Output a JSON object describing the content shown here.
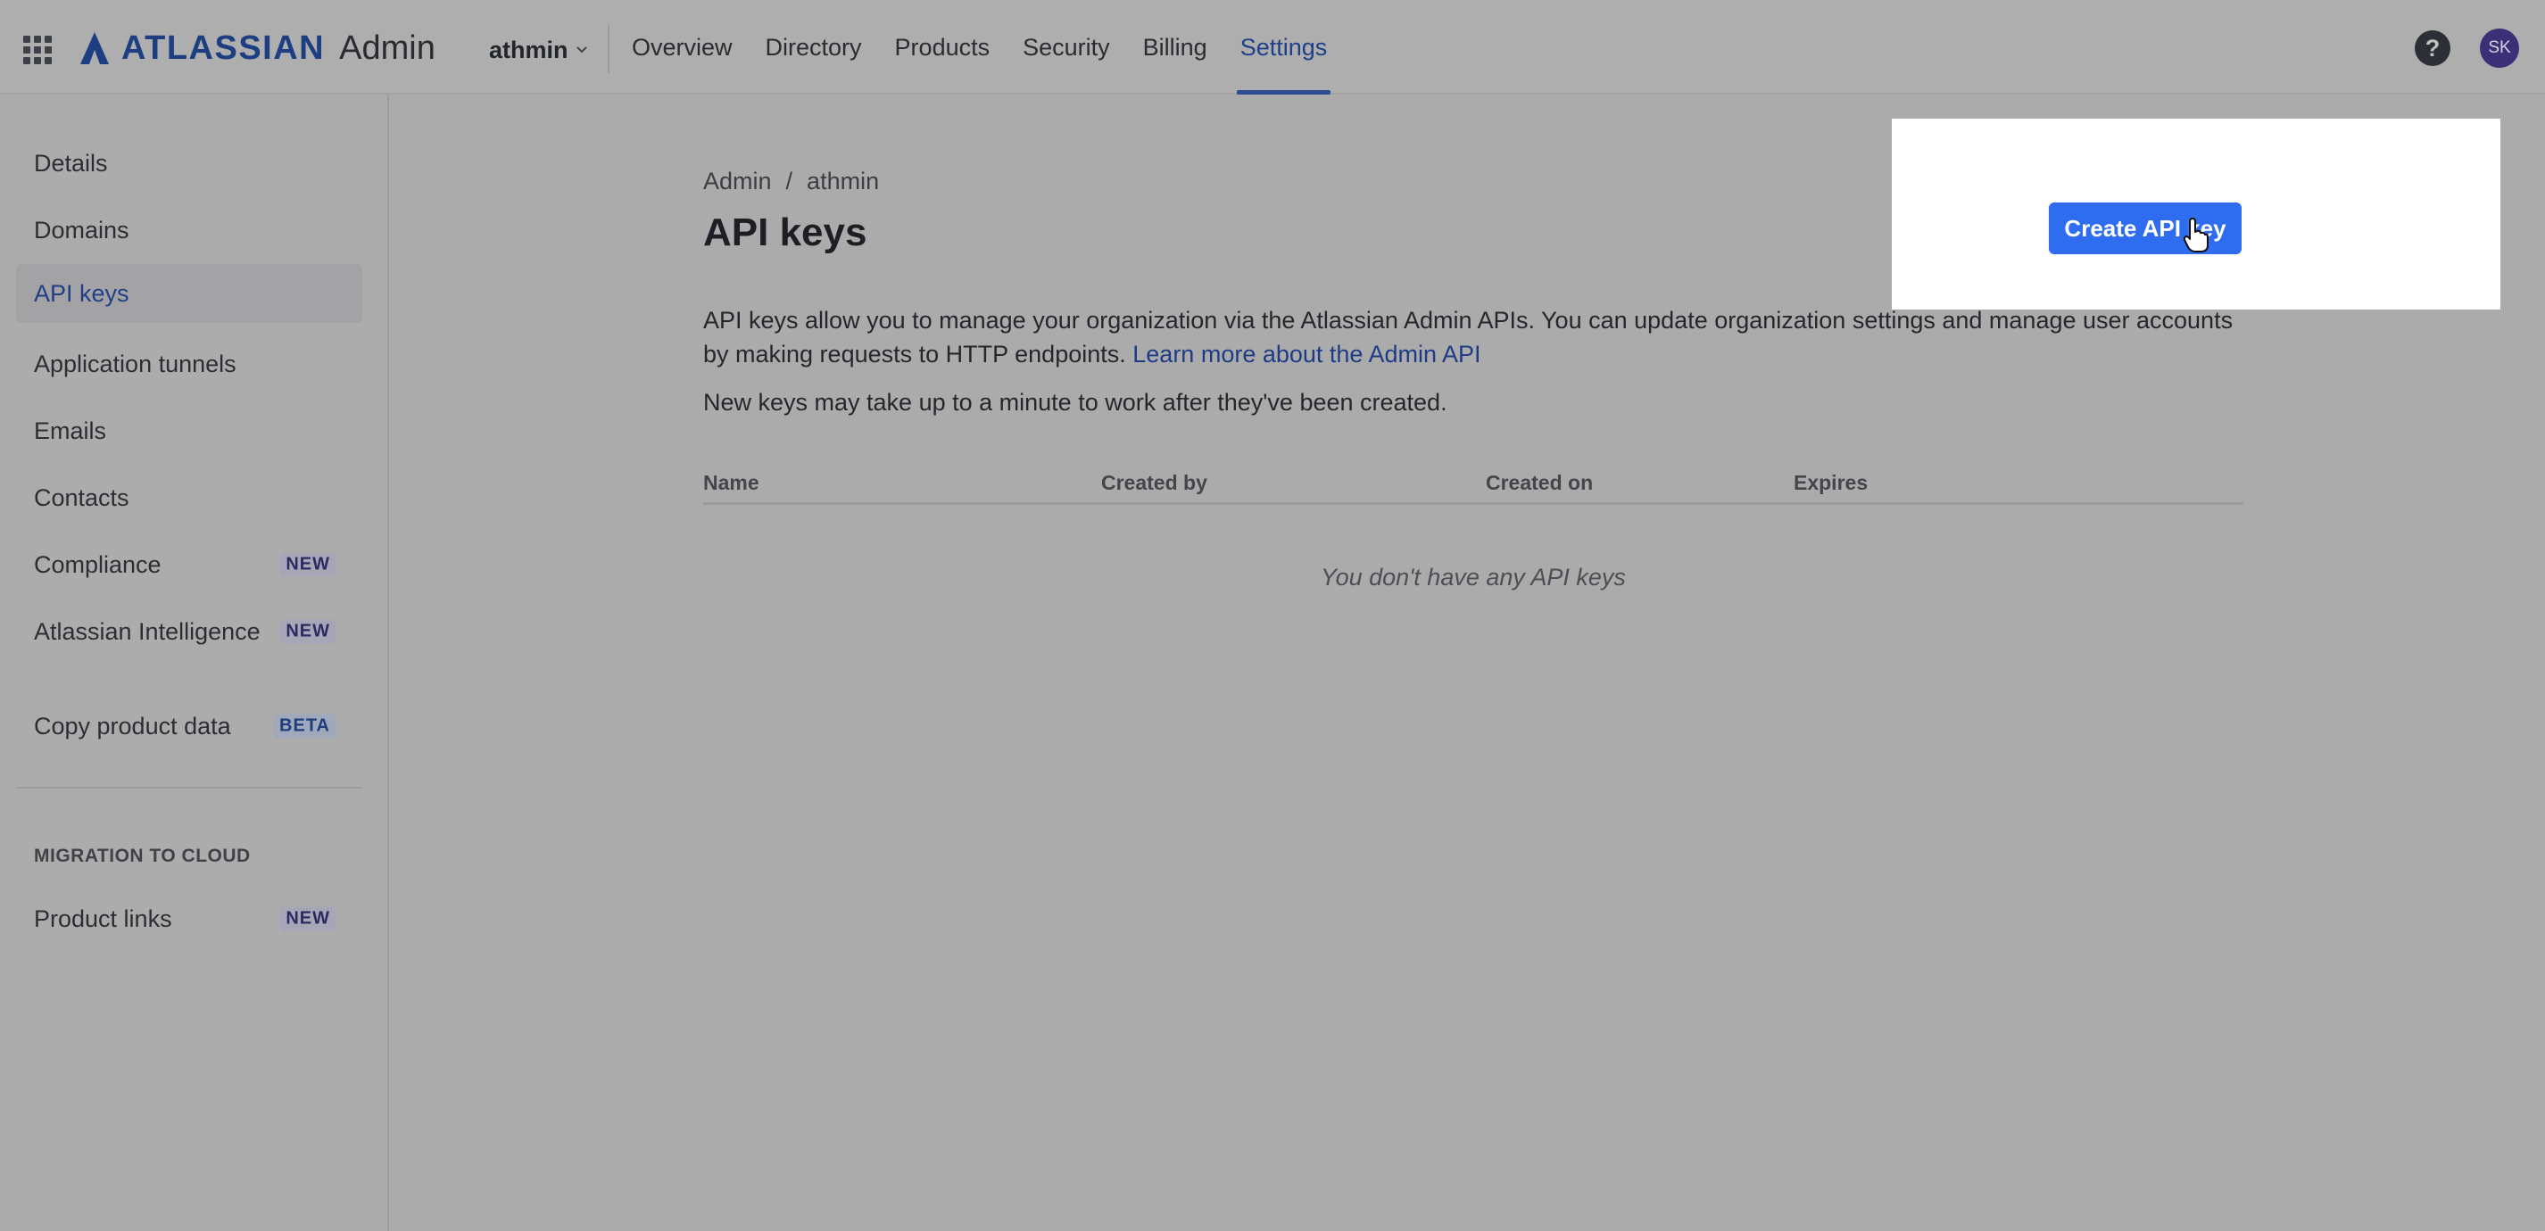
{
  "header": {
    "logo_text": "ATLASSIAN",
    "logo_suffix": "Admin",
    "org_name": "athmin",
    "nav": [
      {
        "label": "Overview"
      },
      {
        "label": "Directory"
      },
      {
        "label": "Products"
      },
      {
        "label": "Security"
      },
      {
        "label": "Billing"
      },
      {
        "label": "Settings",
        "active": true
      }
    ],
    "help_label": "?",
    "avatar_initials": "SK"
  },
  "sidebar": {
    "items": [
      {
        "label": "Details"
      },
      {
        "label": "Domains"
      },
      {
        "label": "API keys",
        "active": true
      },
      {
        "label": "Application tunnels"
      },
      {
        "label": "Emails"
      },
      {
        "label": "Contacts"
      },
      {
        "label": "Compliance",
        "badge": "NEW"
      },
      {
        "label": "Atlassian Intelligence",
        "badge": "NEW"
      },
      {
        "label": "Copy product data",
        "badge": "BETA"
      }
    ],
    "section_title": "MIGRATION TO CLOUD",
    "section_items": [
      {
        "label": "Product links",
        "badge": "NEW"
      }
    ]
  },
  "main": {
    "breadcrumb": [
      "Admin",
      "athmin"
    ],
    "breadcrumb_separator": "/",
    "title": "API keys",
    "description": "API keys allow you to manage your organization via the Atlassian Admin APIs. You can update organization settings and manage user accounts by making requests to HTTP endpoints.",
    "description_link": "Learn more about the Admin API",
    "note": "New keys may take up to a minute to work after they've been created.",
    "table": {
      "columns": [
        "Name",
        "Created by",
        "Created on",
        "Expires"
      ],
      "empty_message": "You don't have any API keys"
    },
    "create_button_label": "Create API key"
  },
  "colors": {
    "accent": "#2f6df0",
    "nav_active": "#1f3f8a",
    "overlay": "#ababab"
  }
}
